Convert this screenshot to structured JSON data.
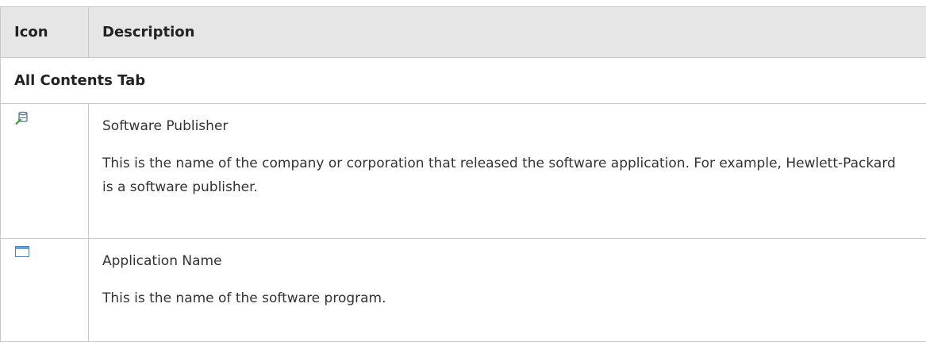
{
  "table": {
    "header": {
      "icon": "Icon",
      "description": "Description"
    },
    "section": {
      "label": "All Contents Tab"
    },
    "rows": [
      {
        "icon": "software-publisher-icon",
        "title": "Software Publisher",
        "body": "This is the name of the company or corporation that released the software application. For example, Hewlett-Packard is a software publisher."
      },
      {
        "icon": "application-window-icon",
        "title": "Application Name",
        "body": "This is the name of the software program."
      }
    ]
  },
  "colors": {
    "header_bg": "#e6e6e6",
    "border": "#c9c9c9",
    "text": "#333333"
  }
}
